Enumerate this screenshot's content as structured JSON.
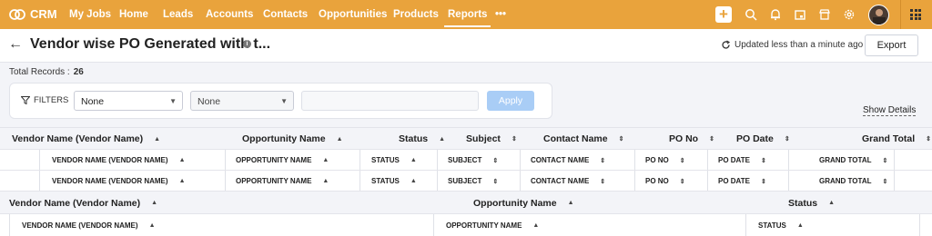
{
  "brand": {
    "name": "CRM"
  },
  "nav": {
    "items": [
      "My Jobs",
      "Home",
      "Leads",
      "Accounts",
      "Contacts",
      "Opportunities",
      "Products",
      "Reports"
    ],
    "more": "•••",
    "active": "Reports"
  },
  "topbar_icons": [
    "plus-icon",
    "search-icon",
    "bell-icon",
    "calendar-icon",
    "store-icon",
    "settings-icon",
    "avatar",
    "apps-grid-icon"
  ],
  "header": {
    "title": "Vendor wise PO Generated with t...",
    "updated": "Updated less than a minute ago",
    "export": "Export"
  },
  "records": {
    "label": "Total Records :",
    "count": "26"
  },
  "filters": {
    "label": "FILTERS",
    "field1": "None",
    "field2": "None",
    "value": "",
    "apply": "Apply"
  },
  "show_details": "Show Details",
  "columns_main": [
    "Vendor Name (Vendor Name)",
    "Opportunity Name",
    "Status",
    "Subject",
    "Contact Name",
    "PO No",
    "PO Date",
    "Grand Total"
  ],
  "columns_sub": [
    "VENDOR NAME (VENDOR NAME)",
    "OPPORTUNITY NAME",
    "STATUS",
    "SUBJECT",
    "CONTACT NAME",
    "PO NO",
    "PO DATE",
    "GRAND TOTAL"
  ],
  "columns_group2": [
    "Vendor Name (Vendor Name)",
    "Opportunity Name",
    "Status"
  ],
  "columns_sub2": [
    "VENDOR NAME (VENDOR NAME)",
    "OPPORTUNITY NAME",
    "STATUS"
  ],
  "sort_icons": {
    "asc": "▲",
    "unsorted": "⇕"
  }
}
